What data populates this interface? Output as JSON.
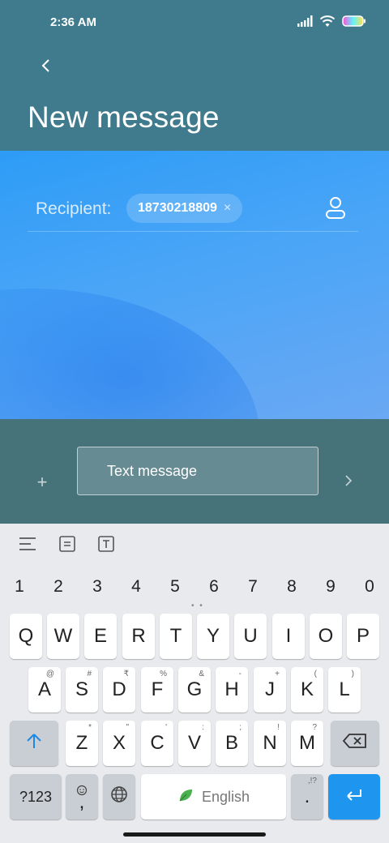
{
  "status_bar": {
    "time": "2:36 AM",
    "icons": [
      "signal-icon",
      "wifi-icon",
      "battery-icon"
    ]
  },
  "header": {
    "back_icon": "chevron-left-icon",
    "title": "New message"
  },
  "recipient": {
    "label": "Recipient:",
    "chip_value": "18730218809",
    "chip_close": "×",
    "contact_icon": "person-icon"
  },
  "composer": {
    "attach_symbol": "+",
    "placeholder": "Text message",
    "send_icon": "chevron-right-icon"
  },
  "keyboard": {
    "toolbar_icons": [
      "menu-lines-icon",
      "clipboard-icon",
      "text-format-icon"
    ],
    "numbers": [
      "1",
      "2",
      "3",
      "4",
      "5",
      "6",
      "7",
      "8",
      "9",
      "0"
    ],
    "dots": "• •",
    "row1": [
      "Q",
      "W",
      "E",
      "R",
      "T",
      "Y",
      "U",
      "I",
      "O",
      "P"
    ],
    "row2": [
      {
        "key": "A",
        "sub": "@"
      },
      {
        "key": "S",
        "sub": "#"
      },
      {
        "key": "D",
        "sub": "₹"
      },
      {
        "key": "F",
        "sub": "%"
      },
      {
        "key": "G",
        "sub": "&"
      },
      {
        "key": "H",
        "sub": "-"
      },
      {
        "key": "J",
        "sub": "+"
      },
      {
        "key": "K",
        "sub": "("
      },
      {
        "key": "L",
        "sub": ")"
      }
    ],
    "row3": [
      {
        "key": "Z",
        "sub": "*"
      },
      {
        "key": "X",
        "sub": "\""
      },
      {
        "key": "C",
        "sub": "'"
      },
      {
        "key": "V",
        "sub": ":"
      },
      {
        "key": "B",
        "sub": ";"
      },
      {
        "key": "N",
        "sub": "!"
      },
      {
        "key": "M",
        "sub": "?"
      }
    ],
    "shift_icon": "shift-arrow-icon",
    "backspace_icon": "backspace-icon",
    "symbols_label": "?123",
    "comma_label": ",",
    "emoji_icon": "emoji-icon",
    "globe_icon": "globe-icon",
    "space_label": "English",
    "space_icon": "leaf-icon",
    "period_label": ".",
    "period_sub": ",!?",
    "enter_icon": "enter-arrow-icon"
  },
  "colors": {
    "header_bg": "#3f7b8c",
    "composer_bg": "#46727a",
    "accent_blue": "#1e96f0"
  }
}
